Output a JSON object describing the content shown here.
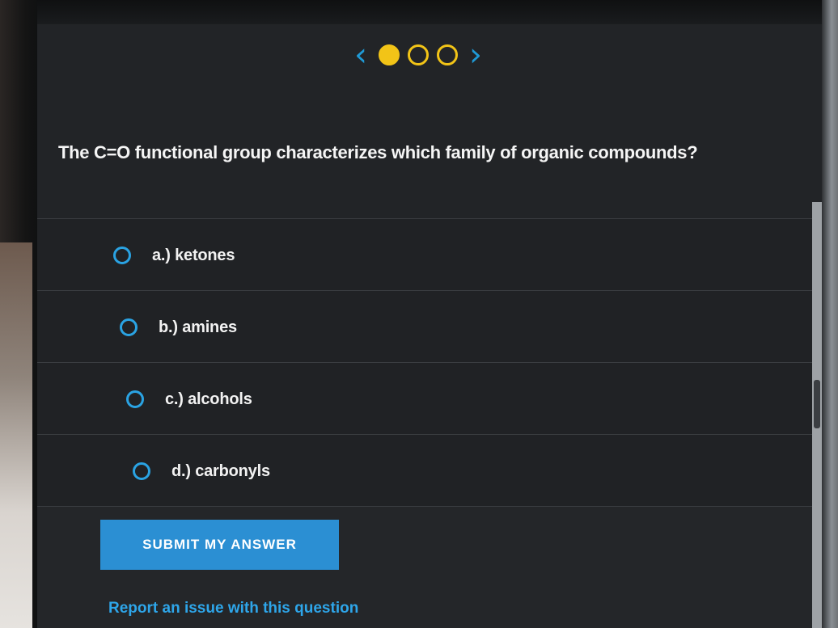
{
  "pager": {
    "prev_icon": "‹",
    "next_icon": "›",
    "dots": [
      {
        "state": "current"
      },
      {
        "state": "empty"
      },
      {
        "state": "empty"
      }
    ],
    "accent_color": "#f2c417"
  },
  "question": {
    "text": "The C=O functional group characterizes which family of organic compounds?"
  },
  "options": [
    {
      "label": "a.) ketones"
    },
    {
      "label": "b.) amines"
    },
    {
      "label": "c.) alcohols"
    },
    {
      "label": "d.) carbonyls"
    }
  ],
  "submit": {
    "label": "SUBMIT MY ANSWER",
    "color": "#2b8fd3"
  },
  "report": {
    "label": "Report an issue with this question"
  }
}
